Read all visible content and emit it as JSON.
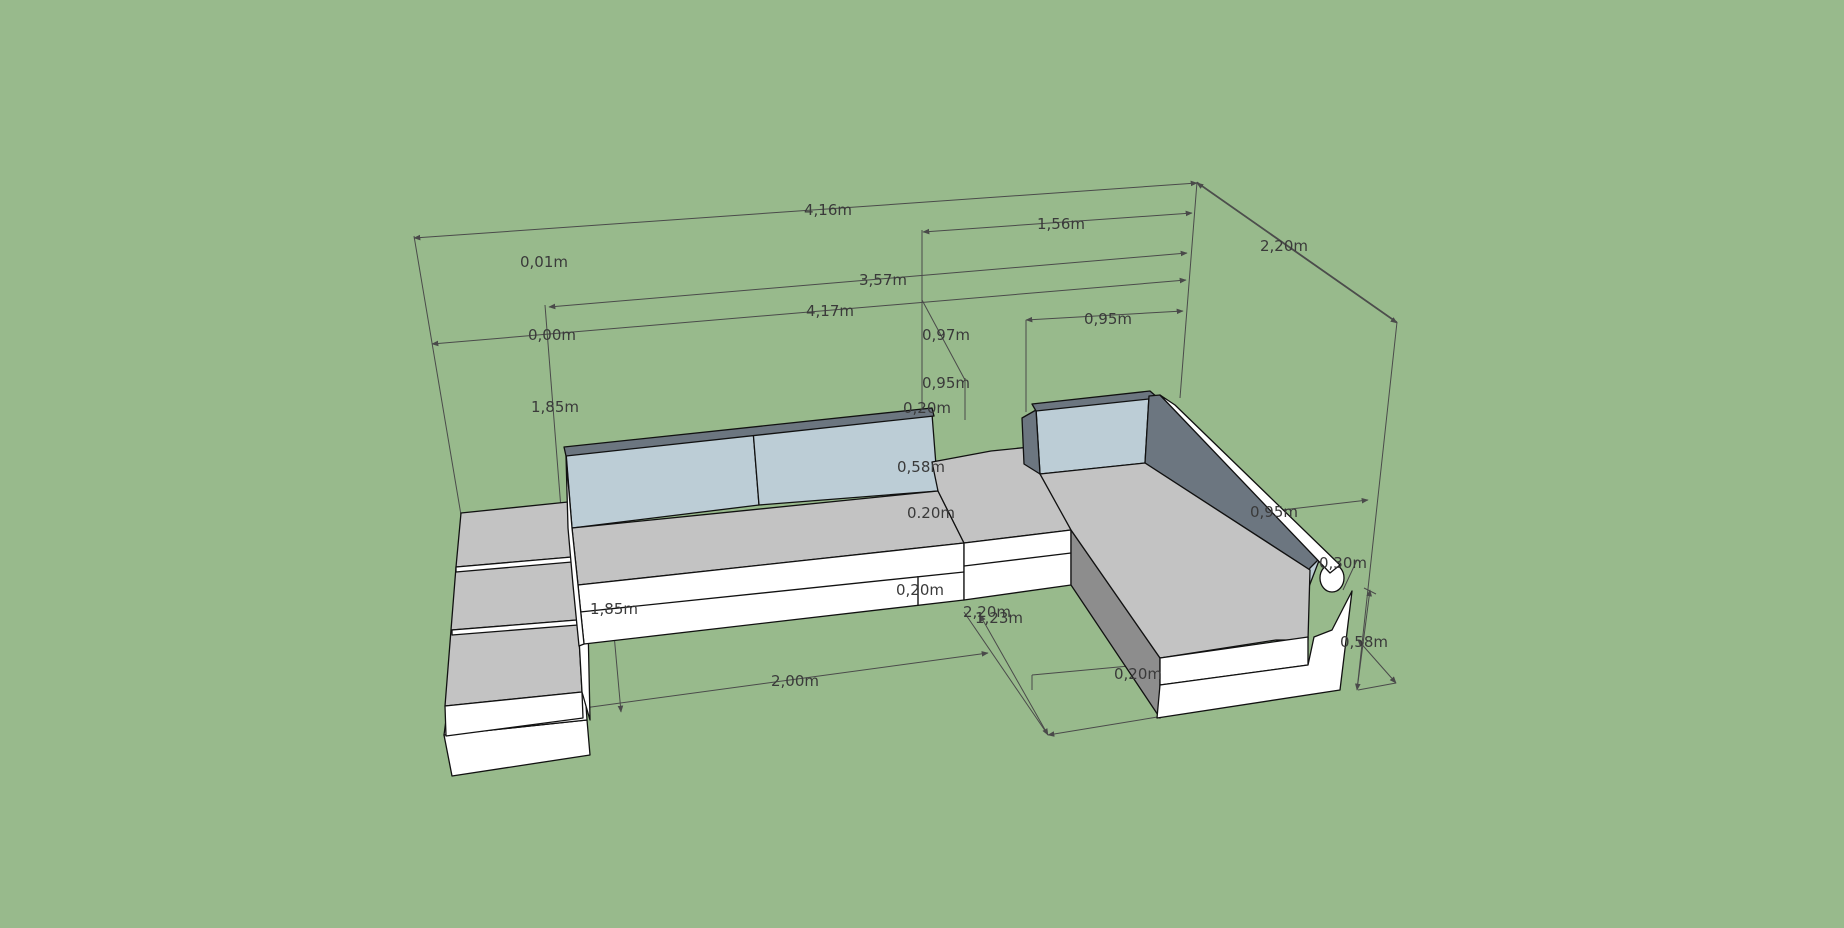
{
  "colors": {
    "background": "#98ba8c",
    "seat_top": "#c3c3c3",
    "side_white": "#ffffff",
    "back_cushion": "#bccdd6",
    "dark_back": "#6c7680",
    "dim_line": "#4a4a4a",
    "dim_text": "#3a3a3a"
  },
  "dimensions": {
    "d_416": "4,16m",
    "d_156": "1,56m",
    "d_220_top": "2,20m",
    "d_001": "0,01m",
    "d_357": "3,57m",
    "d_417": "4,17m",
    "d_000": "0,00m",
    "d_095_top": "0,95m",
    "d_097": "0,97m",
    "d_095_mid": "0,95m",
    "d_020_a": "0,20m",
    "d_185_left": "1,85m",
    "d_058_mid": "0,58m",
    "d_020_b": "0.20m",
    "d_095_right": "0,95m",
    "d_030": "0,30m",
    "d_020_c": "0,20m",
    "d_185_bottom": "1,85m",
    "d_220_mid": "2,20m",
    "d_123": "1,23m",
    "d_058_right": "0,58m",
    "d_020_d": "0,20m",
    "d_200": "2,00m"
  }
}
